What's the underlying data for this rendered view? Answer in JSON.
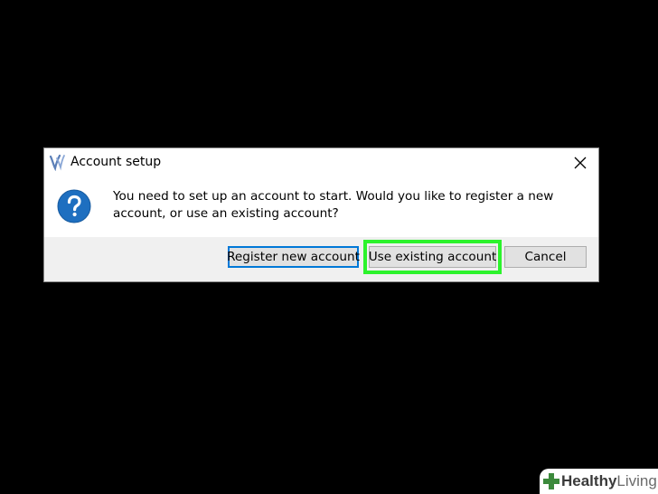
{
  "dialog": {
    "title": "Account setup",
    "message": "You need to set up an account to start. Would you like to register a new account, or use an existing account?",
    "buttons": {
      "register": "Register new account",
      "existing": "Use existing account",
      "cancel": "Cancel"
    }
  },
  "watermark": {
    "brand_bold": "Healthy",
    "brand_light": "Living"
  },
  "colors": {
    "background": "#000000",
    "highlight": "#2cf32c",
    "focus_border": "#0078d7",
    "question_icon": "#1e6fc0",
    "watermark_cross": "#3c8a3c"
  },
  "icons": {
    "app": "app-logo-icon",
    "close": "close-icon",
    "question": "question-icon",
    "watermark": "plus-cross-icon"
  }
}
